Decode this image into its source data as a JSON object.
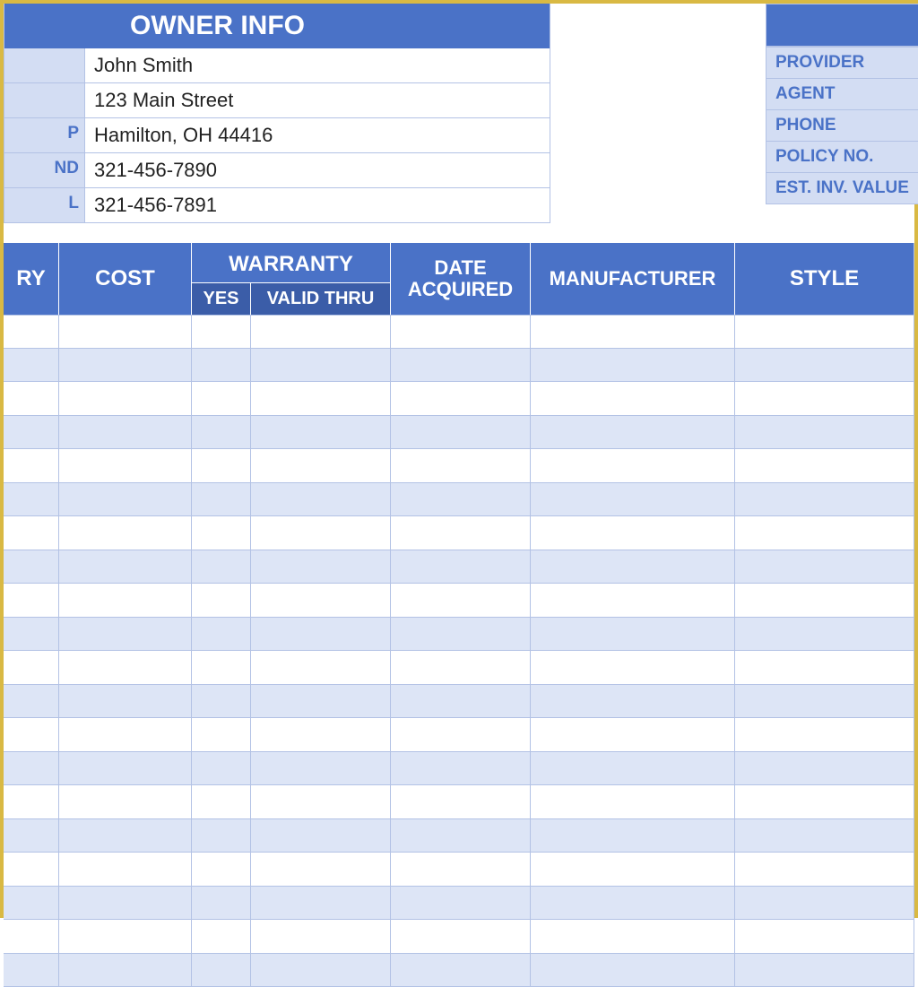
{
  "owner_info": {
    "title": "OWNER INFO",
    "labels": {
      "name": "",
      "address": "",
      "city": "P",
      "phone1": "ND",
      "phone2": "L"
    },
    "name": "John Smith",
    "address": "123 Main Street",
    "city_state_zip": "Hamilton, OH  44416",
    "phone1": "321-456-7890",
    "phone2": "321-456-7891"
  },
  "insurance": {
    "labels": {
      "provider": "PROVIDER",
      "agent": "AGENT",
      "phone": "PHONE",
      "policy": "POLICY NO.",
      "est_value": "EST. INV. VALUE"
    }
  },
  "grid": {
    "headers": {
      "category": "RY",
      "cost": "COST",
      "warranty": "WARRANTY",
      "warranty_yes": "YES",
      "warranty_thru": "VALID THRU",
      "date_acquired": "DATE ACQUIRED",
      "manufacturer": "MANUFACTURER",
      "style": "STYLE"
    },
    "row_count": 20
  },
  "colors": {
    "header_blue": "#4a72c7",
    "sub_blue": "#3b5da8",
    "pale_blue": "#d3ddf3",
    "row_alt": "#dde5f6",
    "border_gold": "#d9b943"
  }
}
